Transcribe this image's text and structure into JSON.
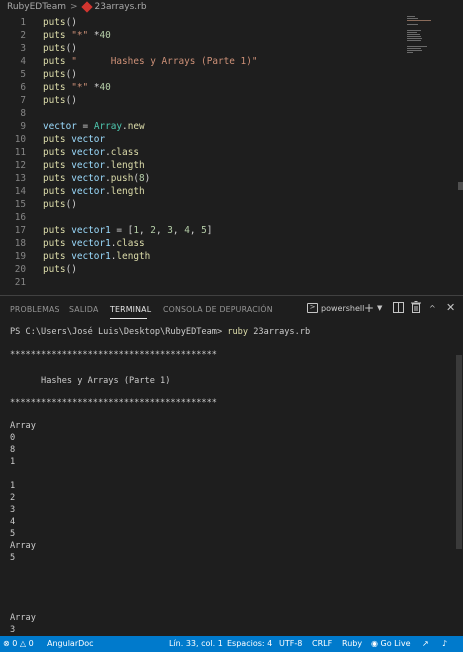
{
  "breadcrumb": {
    "folder": "RubyEDTeam",
    "separator": ">",
    "file": "23arrays.rb"
  },
  "editor": {
    "lines": [
      {
        "num": "1",
        "tokens": [
          [
            "kw",
            "puts"
          ],
          [
            "p",
            "()"
          ]
        ]
      },
      {
        "num": "2",
        "tokens": [
          [
            "kw",
            "puts"
          ],
          [
            "p",
            " "
          ],
          [
            "str",
            "\"*\""
          ],
          [
            "p",
            " *"
          ],
          [
            "num",
            "40"
          ]
        ]
      },
      {
        "num": "3",
        "tokens": [
          [
            "kw",
            "puts"
          ],
          [
            "p",
            "()"
          ]
        ]
      },
      {
        "num": "4",
        "tokens": [
          [
            "kw",
            "puts"
          ],
          [
            "p",
            " "
          ],
          [
            "str",
            "\"      Hashes y Arrays (Parte 1)\""
          ]
        ]
      },
      {
        "num": "5",
        "tokens": [
          [
            "kw",
            "puts"
          ],
          [
            "p",
            "()"
          ]
        ]
      },
      {
        "num": "6",
        "tokens": [
          [
            "kw",
            "puts"
          ],
          [
            "p",
            " "
          ],
          [
            "str",
            "\"*\""
          ],
          [
            "p",
            " *"
          ],
          [
            "num",
            "40"
          ]
        ]
      },
      {
        "num": "7",
        "tokens": [
          [
            "kw",
            "puts"
          ],
          [
            "p",
            "()"
          ]
        ]
      },
      {
        "num": "8",
        "tokens": []
      },
      {
        "num": "9",
        "tokens": [
          [
            "var",
            "vector"
          ],
          [
            "p",
            " = "
          ],
          [
            "const",
            "Array"
          ],
          [
            "p",
            "."
          ],
          [
            "method",
            "new"
          ]
        ]
      },
      {
        "num": "10",
        "tokens": [
          [
            "kw",
            "puts"
          ],
          [
            "p",
            " "
          ],
          [
            "var",
            "vector"
          ]
        ]
      },
      {
        "num": "11",
        "tokens": [
          [
            "kw",
            "puts"
          ],
          [
            "p",
            " "
          ],
          [
            "var",
            "vector"
          ],
          [
            "p",
            "."
          ],
          [
            "method",
            "class"
          ]
        ]
      },
      {
        "num": "12",
        "tokens": [
          [
            "kw",
            "puts"
          ],
          [
            "p",
            " "
          ],
          [
            "var",
            "vector"
          ],
          [
            "p",
            "."
          ],
          [
            "method",
            "length"
          ]
        ]
      },
      {
        "num": "13",
        "tokens": [
          [
            "kw",
            "puts"
          ],
          [
            "p",
            " "
          ],
          [
            "var",
            "vector"
          ],
          [
            "p",
            "."
          ],
          [
            "method",
            "push"
          ],
          [
            "p",
            "("
          ],
          [
            "num",
            "8"
          ],
          [
            "p",
            ")"
          ]
        ]
      },
      {
        "num": "14",
        "tokens": [
          [
            "kw",
            "puts"
          ],
          [
            "p",
            " "
          ],
          [
            "var",
            "vector"
          ],
          [
            "p",
            "."
          ],
          [
            "method",
            "length"
          ]
        ]
      },
      {
        "num": "15",
        "tokens": [
          [
            "kw",
            "puts"
          ],
          [
            "p",
            "()"
          ]
        ]
      },
      {
        "num": "16",
        "tokens": []
      },
      {
        "num": "17",
        "tokens": [
          [
            "kw",
            "puts"
          ],
          [
            "p",
            " "
          ],
          [
            "var",
            "vector1"
          ],
          [
            "p",
            " = ["
          ],
          [
            "num",
            "1"
          ],
          [
            "p",
            ", "
          ],
          [
            "num",
            "2"
          ],
          [
            "p",
            ", "
          ],
          [
            "num",
            "3"
          ],
          [
            "p",
            ", "
          ],
          [
            "num",
            "4"
          ],
          [
            "p",
            ", "
          ],
          [
            "num",
            "5"
          ],
          [
            "p",
            "]"
          ]
        ]
      },
      {
        "num": "18",
        "tokens": [
          [
            "kw",
            "puts"
          ],
          [
            "p",
            " "
          ],
          [
            "var",
            "vector1"
          ],
          [
            "p",
            "."
          ],
          [
            "method",
            "class"
          ]
        ]
      },
      {
        "num": "19",
        "tokens": [
          [
            "kw",
            "puts"
          ],
          [
            "p",
            " "
          ],
          [
            "var",
            "vector1"
          ],
          [
            "p",
            "."
          ],
          [
            "method",
            "length"
          ]
        ]
      },
      {
        "num": "20",
        "tokens": [
          [
            "kw",
            "puts"
          ],
          [
            "p",
            "()"
          ]
        ]
      },
      {
        "num": "21",
        "tokens": []
      }
    ]
  },
  "panel": {
    "tabs": [
      "PROBLEMAS",
      "SALIDA",
      "TERMINAL",
      "CONSOLA DE DEPURACIÓN"
    ],
    "active_tab": "TERMINAL",
    "shell": "powershell",
    "actions": {
      "new_terminal_icon": "plus-icon",
      "dropdown_icon": "chevron-down-icon",
      "split_icon": "split-icon",
      "trash_icon": "trash-icon",
      "maximize_icon": "chevron-up-icon",
      "close_icon": "close-icon"
    }
  },
  "terminal": {
    "prompt": "PS C:\\Users\\José Luis\\Desktop\\RubyEDTeam>",
    "command_ruby": "ruby",
    "command_arg": "23arrays.rb",
    "stars": "****************************************",
    "title_line": "      Hashes y Arrays (Parte 1)",
    "output": [
      "Array",
      "0",
      "8",
      "1",
      "",
      "1",
      "2",
      "3",
      "4",
      "5",
      "Array",
      "5",
      "",
      "",
      "",
      "",
      "Array",
      "3"
    ]
  },
  "statusbar": {
    "errors": "0",
    "warnings": "0",
    "angular": "AngularDoc",
    "position": "Lín. 33, col. 1",
    "spaces": "Espacios: 4",
    "encoding": "UTF-8",
    "eol": "CRLF",
    "language": "Ruby",
    "golive": "Go Live"
  },
  "colors": {
    "editor_bg": "#1e1e1e",
    "status_bg": "#007acc",
    "keyword": "#dcdcaa",
    "string": "#ce9178",
    "number": "#b5cea8",
    "variable": "#9cdcfe",
    "class": "#4ec9b0"
  }
}
